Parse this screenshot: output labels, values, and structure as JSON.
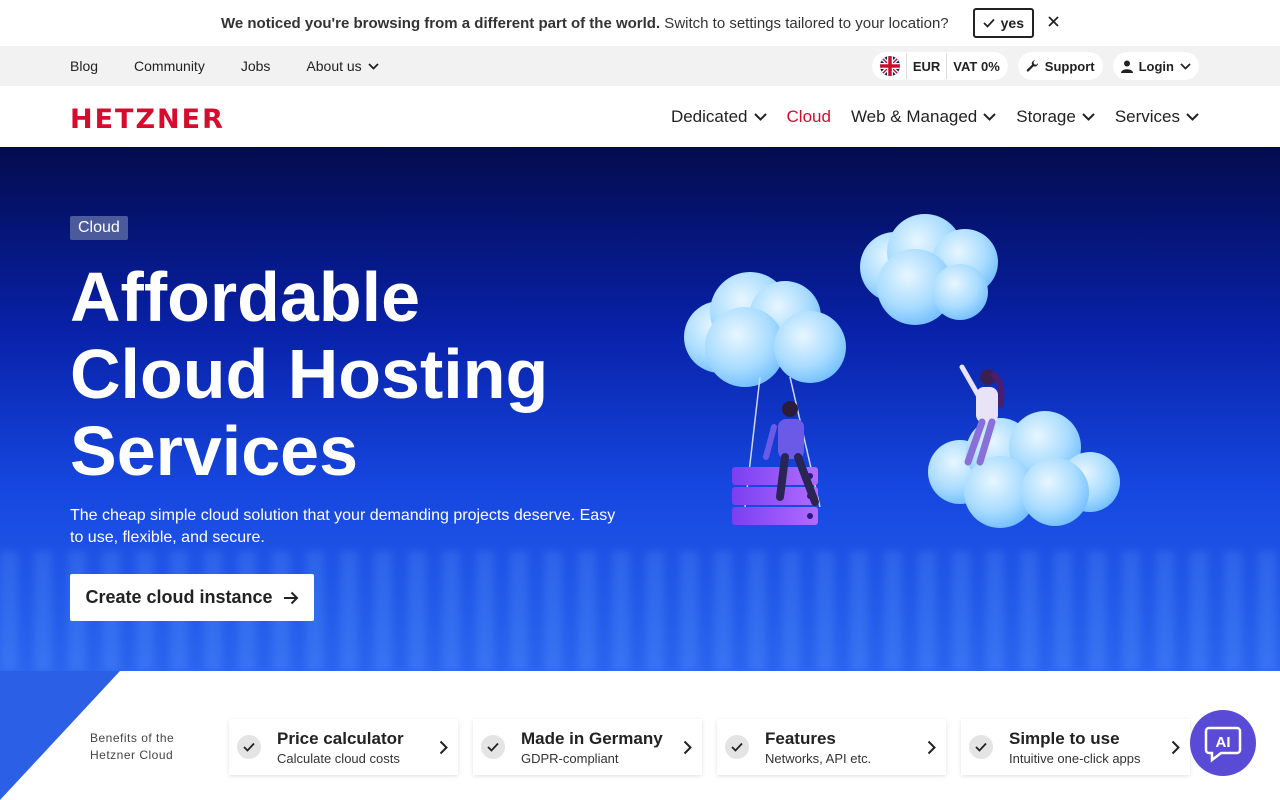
{
  "notice": {
    "bold_text": "We noticed you're browsing from a different part of the world.",
    "text": " Switch to settings tailored to your location?",
    "yes_label": "yes",
    "close_icon": "close-icon"
  },
  "utility": {
    "links": [
      {
        "label": "Blog"
      },
      {
        "label": "Community"
      },
      {
        "label": "Jobs"
      },
      {
        "label": "About us"
      }
    ],
    "currency": "EUR",
    "vat": "VAT 0%",
    "support_label": "Support",
    "login_label": "Login"
  },
  "nav": {
    "logo": "HETZNER",
    "items": [
      {
        "label": "Dedicated"
      },
      {
        "label": "Cloud"
      },
      {
        "label": "Web & Managed"
      },
      {
        "label": "Storage"
      },
      {
        "label": "Services"
      }
    ]
  },
  "hero": {
    "badge": "Cloud",
    "title_line1": "Affordable",
    "title_line2": "Cloud Hosting",
    "title_line3": "Services",
    "subtitle": "The cheap simple cloud solution that your demanding projects deserve. Easy to use, flexible, and secure.",
    "cta_label": "Create cloud instance"
  },
  "benefits": {
    "label_line1": "Benefits of the",
    "label_line2": "Hetzner Cloud",
    "cards": [
      {
        "title": "Price calculator",
        "subtitle": "Calculate cloud costs"
      },
      {
        "title": "Made in Germany",
        "subtitle": "GDPR-compliant"
      },
      {
        "title": "Features",
        "subtitle": "Networks, API etc."
      },
      {
        "title": "Simple to use",
        "subtitle": "Intuitive one-click apps"
      }
    ]
  },
  "ai_button": {
    "label": "AI"
  },
  "colors": {
    "brand_red": "#d50c2d",
    "ai_purple": "#5a4bd6",
    "hero_dark": "#030b4e"
  }
}
